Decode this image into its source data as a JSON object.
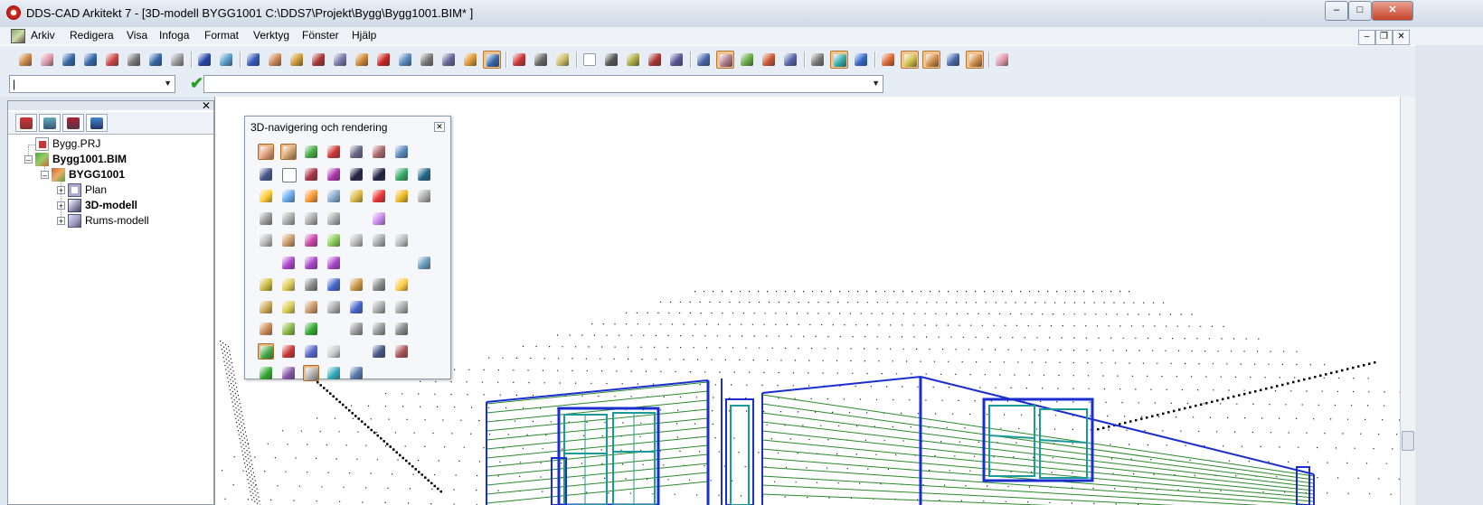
{
  "window": {
    "title": "DDS-CAD Arkitekt 7 - [3D-modell  BYGG1001  C:\\DDS7\\Projekt\\Bygg\\Bygg1001.BIM* ]",
    "minimize_label": "–",
    "maximize_label": "□",
    "close_label": "✕"
  },
  "menu": {
    "items": [
      "Arkiv",
      "Redigera",
      "Visa",
      "Infoga",
      "Format",
      "Verktyg",
      "Fönster",
      "Hjälp"
    ],
    "mdi_minimize": "–",
    "mdi_restore": "❐",
    "mdi_close": "✕"
  },
  "toolbar": {
    "icons": [
      "new-icon",
      "open-icon",
      "save-icon",
      "save-all-icon",
      "close-doc-icon",
      "print-icon",
      "undo-icon",
      "redo-icon",
      "globe-icon",
      "export-icon",
      "help-icon",
      "book-icon",
      "tools-icon",
      "pencil-icon",
      "plot-icon",
      "roof-icon",
      "stairs-icon",
      "fire-icon",
      "ramp-icon",
      "camera-icon",
      "cube-icon",
      "render-icon",
      "flag-icon",
      "g-icon",
      "wrench-icon",
      "edit-icon",
      "blank-icon",
      "eye-icon",
      "move-icon",
      "color-icon",
      "grid-icon",
      "house-view-icon",
      "layers-icon",
      "house-plan-icon",
      "house-red-icon",
      "view-settings-icon",
      "camera-view-icon",
      "copy-view-icon",
      "window-icon",
      "cross-icon",
      "dots-icon",
      "pin-icon",
      "wall-icon",
      "monitor-icon"
    ],
    "active": [
      "render-icon",
      "house-view-icon",
      "camera-view-icon",
      "cross-icon",
      "dots-icon",
      "wall-icon"
    ]
  },
  "cmdbar": {
    "command_value": "|",
    "options_value": ""
  },
  "tree": {
    "items": [
      {
        "label": "Bygg.PRJ",
        "icon": "project-icon"
      },
      {
        "label": "Bygg1001.BIM",
        "icon": "bim-file-icon"
      },
      {
        "label": "BYGG1001",
        "icon": "building-icon"
      },
      {
        "label": "Plan",
        "icon": "plan-icon"
      },
      {
        "label": "3D-modell",
        "icon": "3d-model-icon"
      },
      {
        "label": "Rums-modell",
        "icon": "room-model-icon"
      }
    ]
  },
  "palette": {
    "title": "3D-navigering och rendering",
    "close_label": "✕"
  },
  "colors": {
    "accent_active": "#f2c48c",
    "wireframe_blue": "#1a2ed0",
    "wireframe_green": "#2a8a2a",
    "teal": "#1a9a9a"
  }
}
